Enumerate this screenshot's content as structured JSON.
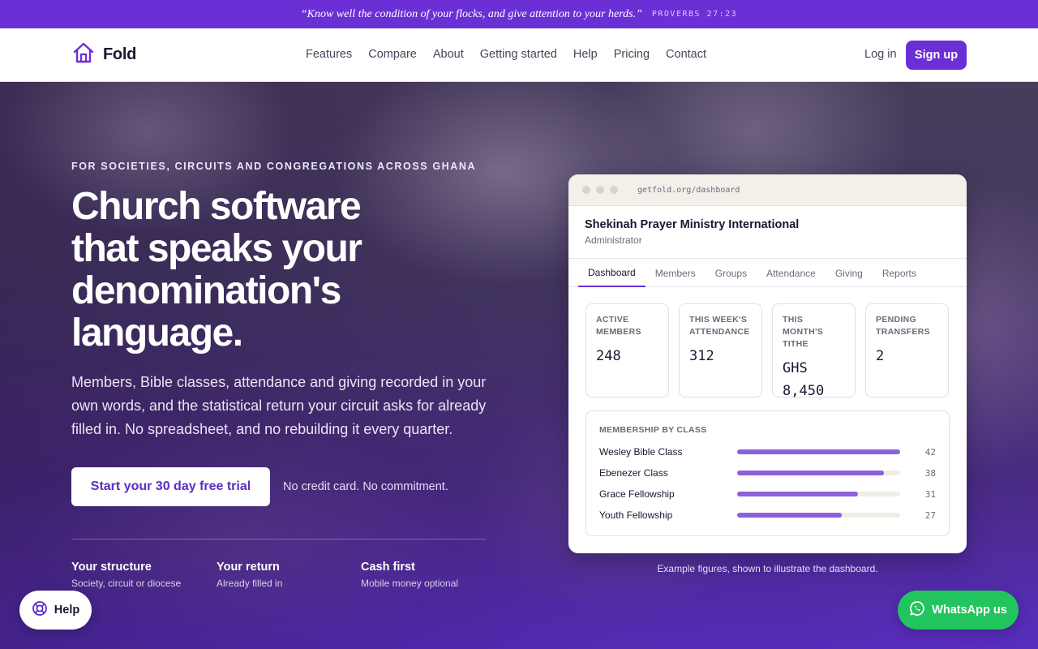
{
  "banner": {
    "quote": "“Know well the condition of your flocks, and give attention to your herds.”",
    "reference": "PROVERBS 27:23"
  },
  "header": {
    "logo_text": "Fold",
    "logo_icon": "house-icon",
    "nav": [
      "Features",
      "Compare",
      "About",
      "Getting started",
      "Help",
      "Pricing",
      "Contact"
    ],
    "login_label": "Log in",
    "signup_label": "Sign up"
  },
  "hero": {
    "eyebrow": "FOR SOCIETIES, CIRCUITS AND CONGREGATIONS ACROSS GHANA",
    "headline": "Church software that speaks your denomination's language.",
    "subtext": "Members, Bible classes, attendance and giving recorded in your own words, and the statistical return your circuit asks for already filled in. No spreadsheet, and no rebuilding it every quarter.",
    "cta_label": "Start your 30 day free trial",
    "cta_note": "No credit card. No commitment.",
    "features": [
      {
        "title": "Your structure",
        "subtitle": "Society, circuit or diocese"
      },
      {
        "title": "Your return",
        "subtitle": "Already filled in"
      },
      {
        "title": "Cash first",
        "subtitle": "Mobile money optional"
      }
    ]
  },
  "dashboard": {
    "url": "getfold.org/dashboard",
    "org_name": "Shekinah Prayer Ministry International",
    "role": "Administrator",
    "tabs": [
      "Dashboard",
      "Members",
      "Groups",
      "Attendance",
      "Giving",
      "Reports"
    ],
    "active_tab": "Dashboard",
    "stats": [
      {
        "label": "ACTIVE MEMBERS",
        "value": "248"
      },
      {
        "label": "THIS WEEK'S ATTENDANCE",
        "value": "312"
      },
      {
        "label": "THIS MONTH'S TITHE",
        "value": "GHS 8,450"
      },
      {
        "label": "PENDING TRANSFERS",
        "value": "2"
      }
    ],
    "classes_title": "MEMBERSHIP BY CLASS",
    "classes": [
      {
        "name": "Wesley Bible Class",
        "count": "42",
        "fraction": 1.0
      },
      {
        "name": "Ebenezer Class",
        "count": "38",
        "fraction": 0.9
      },
      {
        "name": "Grace Fellowship",
        "count": "31",
        "fraction": 0.74
      },
      {
        "name": "Youth Fellowship",
        "count": "27",
        "fraction": 0.64
      }
    ],
    "note": "Example figures, shown to illustrate the dashboard."
  },
  "floating": {
    "help_label": "Help",
    "help_icon": "lifebuoy-icon",
    "whatsapp_label": "WhatsApp us",
    "whatsapp_icon": "whatsapp-icon"
  },
  "colors": {
    "brand": "#6b2fd6",
    "whatsapp": "#22c45e"
  }
}
